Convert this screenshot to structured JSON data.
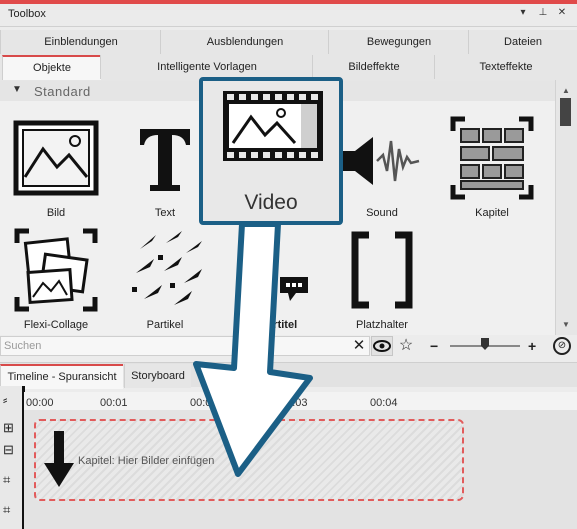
{
  "window": {
    "title": "Toolbox"
  },
  "tabs_row1": [
    "Einblendungen",
    "Ausblendungen",
    "Bewegungen",
    "Dateien"
  ],
  "tabs_row2": [
    "Objekte",
    "Intelligente Vorlagen",
    "Bildeffekte",
    "Texteffekte"
  ],
  "category": "Standard",
  "objects": [
    {
      "label": "Bild"
    },
    {
      "label": "Text"
    },
    {
      "label": "Video"
    },
    {
      "label": "Sound"
    },
    {
      "label": "Kapitel"
    },
    {
      "label": "Flexi-Collage"
    },
    {
      "label": "Partikel"
    },
    {
      "label": "Untertitel"
    },
    {
      "label": "Platzhalter"
    }
  ],
  "callout": {
    "label": "Video"
  },
  "search": {
    "placeholder": "Suchen"
  },
  "timeline": {
    "tabs": [
      "Timeline - Spuransicht",
      "Storyboard"
    ],
    "ticks": [
      "00:00",
      "00:01",
      "00:02",
      "00:03",
      "00:04"
    ],
    "chapter_hint": "Kapitel: Hier Bilder einfügen",
    "zoom_level": 0.62
  },
  "colors": {
    "accent_red": "#d84a4a",
    "callout_blue": "#1b5f86"
  }
}
